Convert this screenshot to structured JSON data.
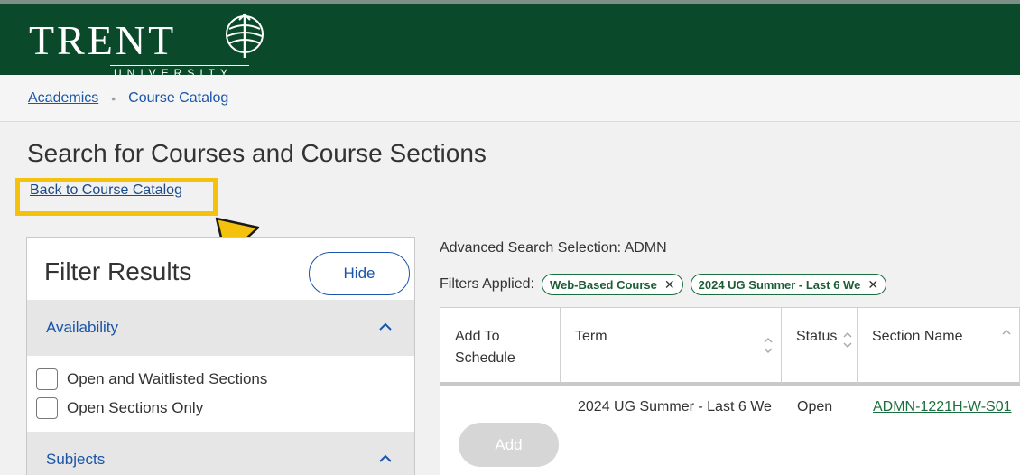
{
  "header": {
    "logo_text": "TRENT",
    "logo_subtext": "UNIVERSITY"
  },
  "breadcrumb": {
    "items": [
      {
        "label": "Academics"
      },
      {
        "label": "Course Catalog"
      }
    ],
    "separator": "•"
  },
  "page": {
    "title": "Search for Courses and Course Sections",
    "back_link": "Back to Course Catalog"
  },
  "filter_panel": {
    "title": "Filter Results",
    "hide_label": "Hide",
    "sections": [
      {
        "label": "Availability",
        "options": [
          "Open and Waitlisted Sections",
          "Open Sections Only"
        ]
      },
      {
        "label": "Subjects",
        "options": []
      }
    ]
  },
  "results": {
    "advanced_search": "Advanced Search Selection: ADMN",
    "filters_label": "Filters Applied:",
    "chips": [
      "Web-Based Course",
      "2024 UG Summer - Last 6 We"
    ],
    "columns": [
      "Add To Schedule",
      "Term",
      "Status",
      "Section Name"
    ],
    "rows": [
      {
        "term": "2024 UG Summer - Last 6 We",
        "status": "Open",
        "section_name": "ADMN-1221H-W-S01",
        "add_label": "Add"
      }
    ]
  },
  "colors": {
    "header_bg": "#0a4a2a",
    "link_blue": "#1a55a8",
    "highlight_yellow": "#f4c20d",
    "chip_green": "#1b6e3d"
  },
  "icons": {
    "logo_mark": "trent-crest-icon",
    "collapse": "chevron-up-icon",
    "sort": "sort-arrows-icon",
    "remove_chip": "close-icon",
    "annotation": "arrow-annotation-icon"
  }
}
